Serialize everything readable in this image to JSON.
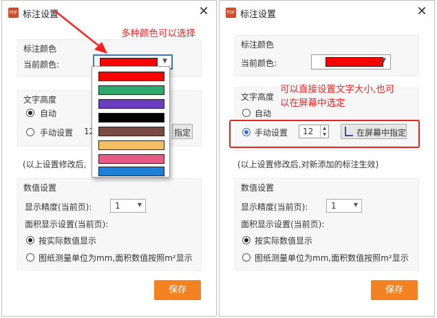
{
  "colors": {
    "accent_red": "#ff0000",
    "save_orange": "#f58220",
    "annotation_red": "#ff1f1f"
  },
  "left": {
    "title": "标注设置",
    "color_group_title": "标注颜色",
    "current_color_label": "当前颜色:",
    "current_color": "#ff0000",
    "color_options": [
      "#ff0000",
      "#2ea86b",
      "#6a3cc0",
      "#000000",
      "#7b4a42",
      "#f5c061",
      "#e85a86",
      "#1e7fd6"
    ],
    "text_height_title": "文字高度",
    "auto_label": "自动",
    "manual_label": "手动设置",
    "manual_value": "12",
    "pick_partial": "指定",
    "hint_partial": "(以上设置修改后,",
    "numeric_title": "数值设置",
    "precision_label": "显示精度(当前页):",
    "precision_value": "1",
    "area_label": "面积显示设置(当前页):",
    "area_option1": "按实际数值显示",
    "area_option2": "图纸测量单位为mm,面积数值按照m²显示",
    "save_label": "保存"
  },
  "right": {
    "title": "标注设置",
    "color_group_title": "标注颜色",
    "current_color_label": "当前颜色:",
    "current_color": "#ff0000",
    "text_height_title": "文字高度",
    "auto_label": "自动",
    "manual_label": "手动设置",
    "manual_value": "12",
    "pick_label": "在屏幕中指定",
    "hint": "(以上设置修改后,对新添加的标注生效)",
    "numeric_title": "数值设置",
    "precision_label": "显示精度(当前页):",
    "precision_value": "1",
    "area_label": "面积显示设置(当前页):",
    "area_option1": "按实际数值显示",
    "area_option2": "图纸测量单位为mm,面积数值按照m²显示",
    "save_label": "保存"
  },
  "annotations": {
    "colors_note": "多种颜色可以选择",
    "text_size_note_line1": "可以直接设置文字大小,也可",
    "text_size_note_line2": "以在屏幕中选定"
  },
  "icons": {
    "app": "pdf-app-icon",
    "close": "close-icon",
    "caret": "chevron-down-icon",
    "pick": "screen-pick-icon"
  }
}
